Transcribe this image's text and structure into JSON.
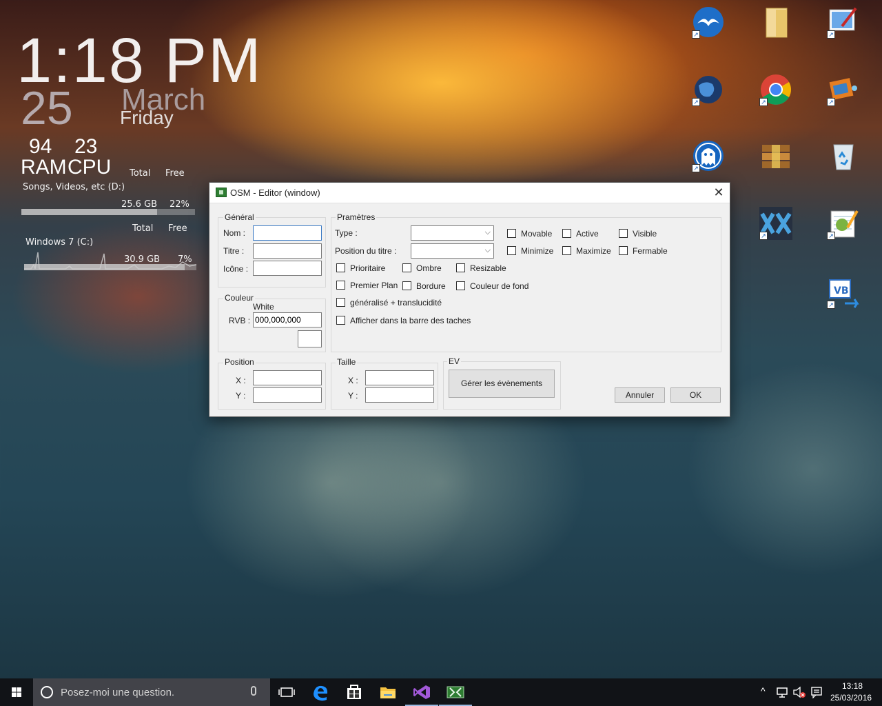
{
  "widget": {
    "time": "1:18 PM",
    "day": "25",
    "month": "March",
    "weekday": "Friday",
    "ram_value": "94",
    "cpu_value": "23",
    "ram_label": "RAM",
    "cpu_label": "CPU",
    "total_label": "Total",
    "free_label": "Free",
    "drive_d": {
      "name": "Songs, Videos, etc (D:)",
      "total": "25.6 GB",
      "free": "22%",
      "used_fraction": 0.78
    },
    "drive_c": {
      "name": "Windows 7 (C:)",
      "total": "30.9 GB",
      "free": "7%",
      "used_fraction": 0.93
    }
  },
  "desktop_icons": [
    "openoffice-icon",
    "folder-icon",
    "paint-icon",
    "globe-icon",
    "chrome-icon",
    "movie-maker-icon",
    "ghost-app-icon",
    "archive-icon",
    "recycle-bin-icon",
    "xx-app-icon",
    "notepad-icon",
    "vb-icon"
  ],
  "window": {
    "title": "OSM - Editor (window)",
    "general": {
      "legend": "Général",
      "name_label": "Nom :",
      "title_label": "Titre :",
      "icon_label": "Icône :",
      "name_value": "",
      "title_value": "",
      "icon_value": ""
    },
    "color": {
      "legend": "Couleur",
      "color_name": "White",
      "rgb_label": "RVB :",
      "rgb_value": "000,000,000"
    },
    "params": {
      "legend": "Pramètres",
      "type_label": "Type :",
      "title_pos_label": "Position du titre :",
      "checkboxes": {
        "movable": "Movable",
        "active": "Active",
        "visible": "Visible",
        "minimize": "Minimize",
        "maximize": "Maximize",
        "fermable": "Fermable",
        "prioritaire": "Prioritaire",
        "ombre": "Ombre",
        "resizable": "Resizable",
        "premier_plan": "Premier Plan",
        "bordure": "Bordure",
        "couleur_fond": "Couleur de fond",
        "generalise": "généralisé + translucidité",
        "afficher_barre": "Afficher dans la barre des taches"
      }
    },
    "position": {
      "legend": "Position",
      "x_label": "X :",
      "y_label": "Y :"
    },
    "size": {
      "legend": "Taille",
      "x_label": "X :",
      "y_label": "Y :"
    },
    "events": {
      "legend": "EV",
      "button": "Gérer les évènements"
    },
    "cancel_button": "Annuler",
    "ok_button": "OK"
  },
  "taskbar": {
    "search_placeholder": "Posez-moi une question.",
    "time": "13:18",
    "date": "25/03/2016"
  }
}
